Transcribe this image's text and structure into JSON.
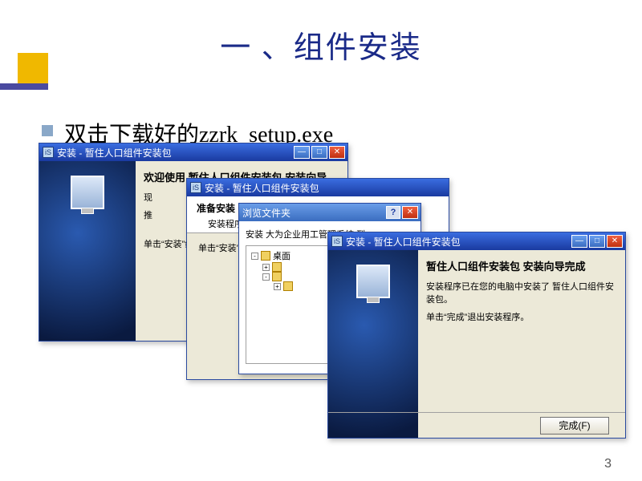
{
  "slide": {
    "title": "一 、组件安装",
    "bullet": "双击下载好的zzrk_setup.exe",
    "page_number": "3"
  },
  "win1": {
    "title": "安装 - 暂住人口组件安装包",
    "heading": "欢迎使用  暂住人口组件安装包  安装向导",
    "line_a_prefix": "现",
    "line_b_prefix": "推",
    "line_c": "单击“安装”继续此安装"
  },
  "win2": {
    "title": "安装 - 暂住人口组件安装包",
    "hdr_title": "准备安装",
    "hdr_sub": "安装程序现在准备开始安装",
    "body_line": "单击“安装”继续此安装"
  },
  "win3": {
    "title": "浏览文件夹",
    "instr": "安装 大为企业用工管理系统 到：",
    "tree_root": "桌面",
    "help": "?"
  },
  "win4": {
    "title": "安装 - 暂住人口组件安装包",
    "heading": "暂住人口组件安装包  安装向导完成",
    "line_a": "安装程序已在您的电脑中安装了 暂住人口组件安装包。",
    "line_b": "单击“完成”退出安装程序。",
    "finish_btn": "完成(F)"
  },
  "tb": {
    "min": "—",
    "max": "□",
    "close": "✕"
  }
}
